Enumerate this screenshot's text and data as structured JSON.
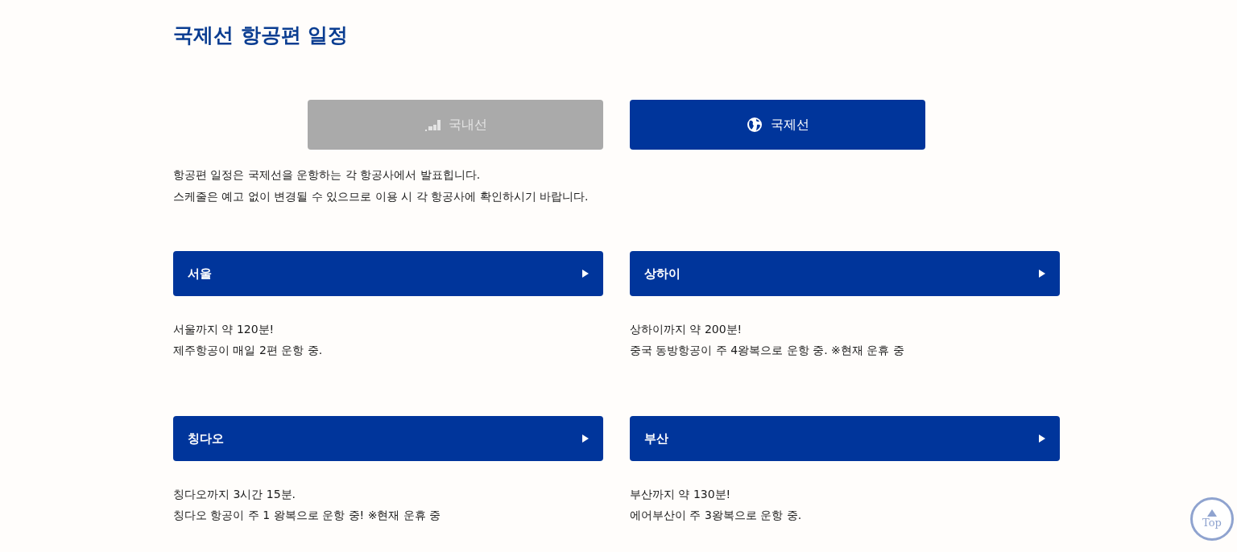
{
  "page_title": "국제선 항공편 일정",
  "tabs": [
    {
      "label": "국내선",
      "selected": false
    },
    {
      "label": "국제선",
      "selected": true
    }
  ],
  "notice": [
    "항공편 일정은 국제선을 운항하는 각 항공사에서 발표힙니다.",
    "스케줄은 예고 없이 변경될 수 있으므로 이용 시 각 항공사에 확인하시기 바랍니다."
  ],
  "destinations": [
    {
      "name": "서울",
      "lines": [
        "서울까지 약 120분!",
        "제주항공이 매일 2편 운항 중."
      ]
    },
    {
      "name": "상하이",
      "lines": [
        "상하이까지 약 200분!",
        "중국 동방항공이 주 4왕복으로 운항 중. ※현재 운휴 중"
      ]
    },
    {
      "name": "칭다오",
      "lines": [
        "칭다오까지 3시간 15분.",
        "칭다오 항공이 주 1 왕복으로 운항 중! ※현재 운휴 중"
      ]
    },
    {
      "name": "부산",
      "lines": [
        "부산까지 약 130분!",
        "에어부산이 주 3왕복으로 운항 중."
      ]
    }
  ],
  "top_button": {
    "label": "Top"
  }
}
